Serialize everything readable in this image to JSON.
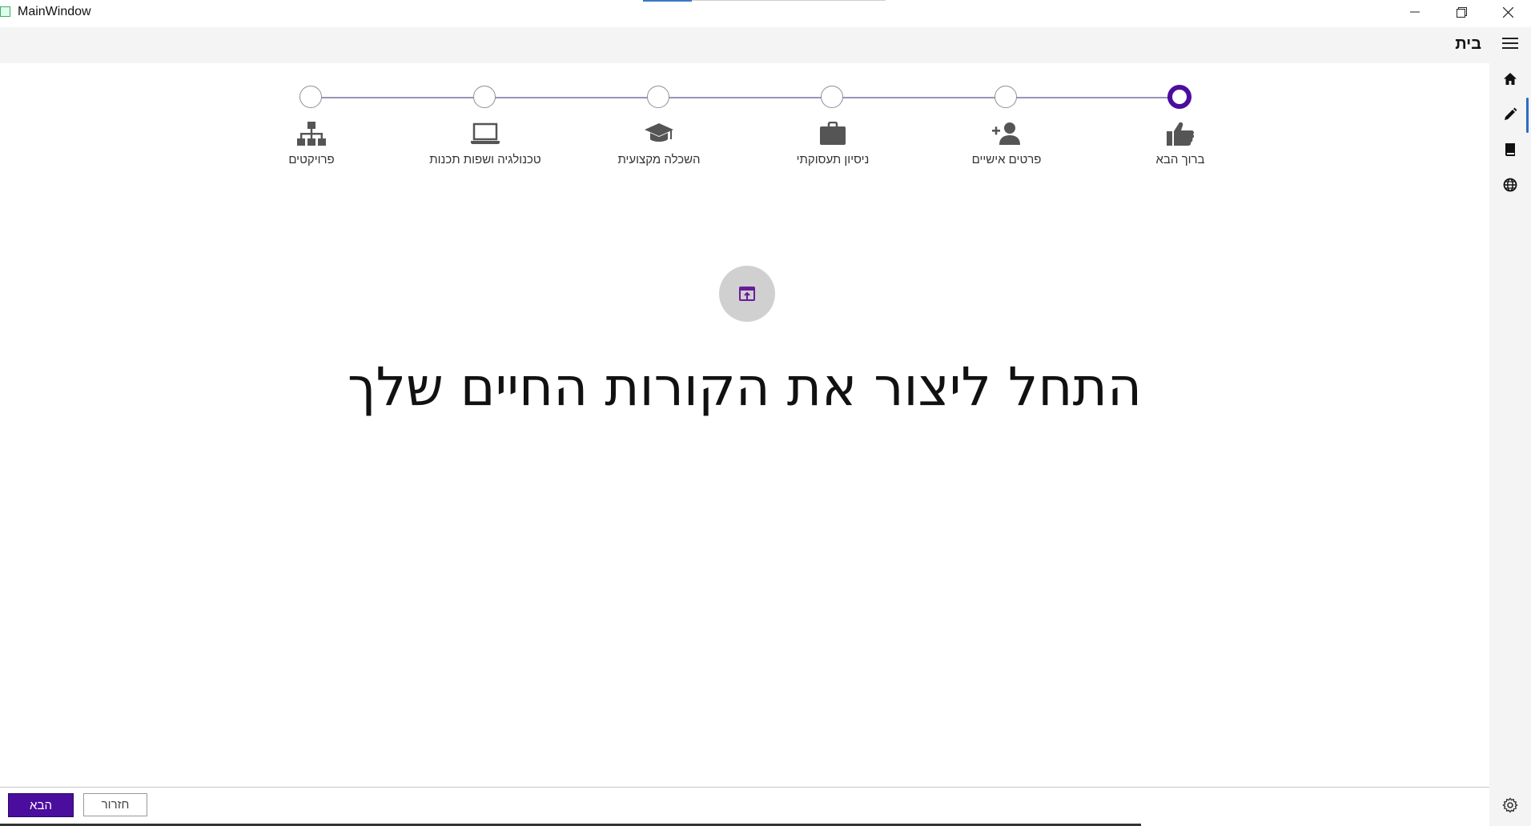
{
  "window": {
    "title": "MainWindow"
  },
  "header": {
    "title": "בית"
  },
  "rail": {
    "items": [
      {
        "icon": "home-icon"
      },
      {
        "icon": "pen-icon"
      },
      {
        "icon": "book-icon"
      },
      {
        "icon": "globe-icon"
      }
    ],
    "active_index": 1
  },
  "stepper": {
    "active_index": 0,
    "accent": "#4b0d9e",
    "steps": [
      {
        "label": "ברוך הבא",
        "icon": "thumbs-up-icon"
      },
      {
        "label": "פרטים אישיים",
        "icon": "add-person-icon"
      },
      {
        "label": "ניסיון תעסוקתי",
        "icon": "briefcase-icon"
      },
      {
        "label": "השכלה מקצועית",
        "icon": "graduation-cap-icon"
      },
      {
        "label": "טכנולגיה ושפות תכנות",
        "icon": "laptop-icon"
      },
      {
        "label": "פרויקטים",
        "icon": "sitemap-icon"
      }
    ]
  },
  "main": {
    "badge_icon": "open-in-window-icon",
    "headline": "התחל ליצור את הקורות החיים שלך"
  },
  "footer": {
    "next_label": "הבא",
    "back_label": "חזרור"
  }
}
